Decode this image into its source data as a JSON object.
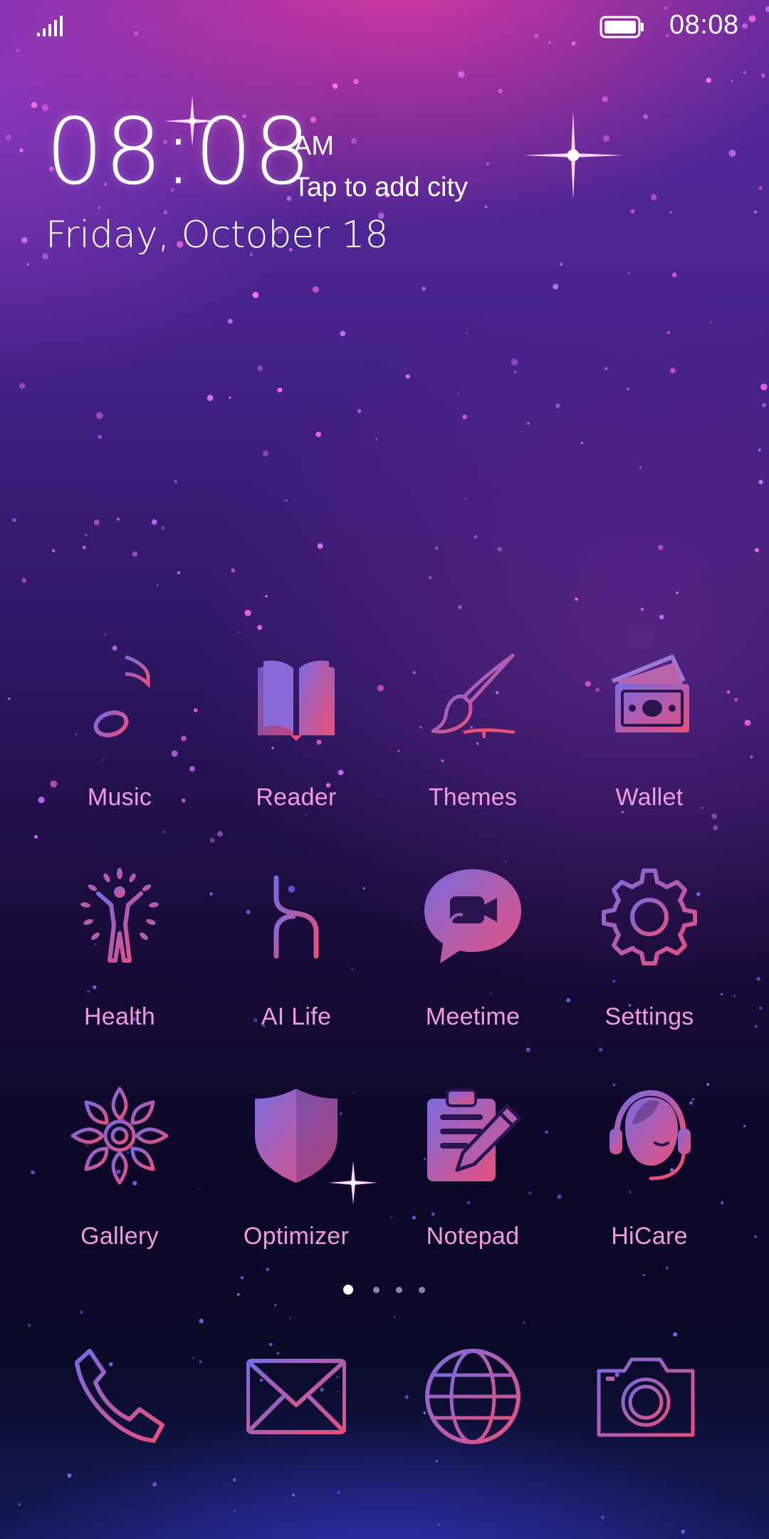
{
  "status_bar": {
    "time": "08:08"
  },
  "clock_widget": {
    "time": "08:08",
    "ampm": "AM",
    "city_prompt": "Tap to add city",
    "date": "Friday, October 18"
  },
  "apps": [
    {
      "label": "Music",
      "icon": "music-note-icon"
    },
    {
      "label": "Reader",
      "icon": "book-icon"
    },
    {
      "label": "Themes",
      "icon": "paintbrush-icon"
    },
    {
      "label": "Wallet",
      "icon": "wallet-icon"
    },
    {
      "label": "Health",
      "icon": "health-person-icon"
    },
    {
      "label": "AI Life",
      "icon": "ai-life-icon"
    },
    {
      "label": "Meetime",
      "icon": "video-chat-icon"
    },
    {
      "label": "Settings",
      "icon": "gear-icon"
    },
    {
      "label": "Gallery",
      "icon": "flower-icon"
    },
    {
      "label": "Optimizer",
      "icon": "shield-icon"
    },
    {
      "label": "Notepad",
      "icon": "clipboard-pencil-icon"
    },
    {
      "label": "HiCare",
      "icon": "headset-support-icon"
    }
  ],
  "page_indicator": {
    "pages": 4,
    "current": 1
  },
  "dock": [
    {
      "icon": "phone-icon"
    },
    {
      "icon": "mail-icon"
    },
    {
      "icon": "globe-icon"
    },
    {
      "icon": "camera-icon"
    }
  ],
  "colors": {
    "icon_gradient_start": "#7a6ae0",
    "icon_gradient_end": "#e8507a",
    "label": "#f29ae0"
  }
}
